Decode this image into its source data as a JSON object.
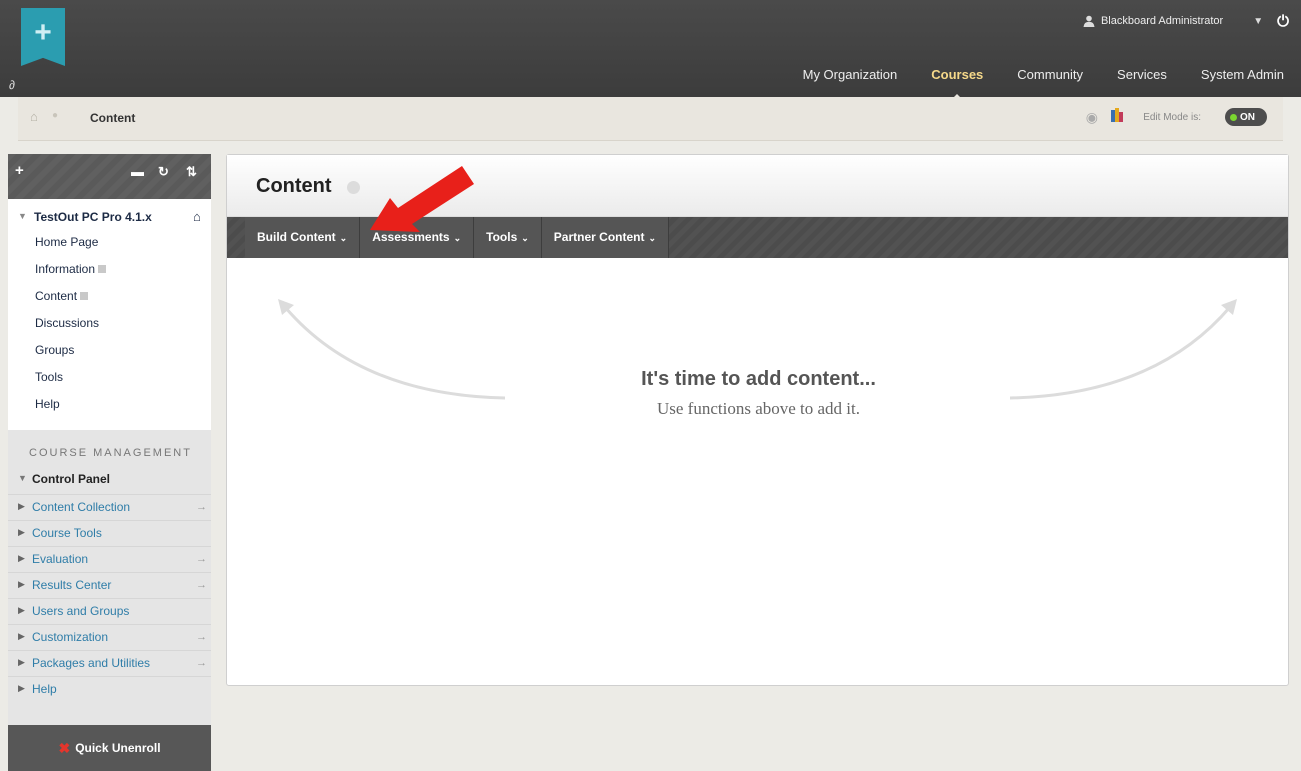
{
  "header": {
    "user_name": "Blackboard Administrator",
    "nav_tabs": [
      "My Organization",
      "Courses",
      "Community",
      "Services",
      "System Admin"
    ],
    "active_tab": "Courses"
  },
  "breadcrumb": {
    "current": "Content",
    "edit_mode_label": "Edit Mode is:",
    "edit_mode_state": "ON"
  },
  "course_menu": {
    "course_title": "TestOut PC Pro 4.1.x",
    "links": [
      "Home Page",
      "Information",
      "Content",
      "Discussions",
      "Groups",
      "Tools",
      "Help"
    ],
    "management_heading": "COURSE MANAGEMENT",
    "control_panel_label": "Control Panel",
    "control_panel_items": [
      {
        "label": "Content Collection",
        "arrow": true
      },
      {
        "label": "Course Tools",
        "arrow": false
      },
      {
        "label": "Evaluation",
        "arrow": true
      },
      {
        "label": "Results Center",
        "arrow": true
      },
      {
        "label": "Users and Groups",
        "arrow": false
      },
      {
        "label": "Customization",
        "arrow": true
      },
      {
        "label": "Packages and Utilities",
        "arrow": true
      },
      {
        "label": "Help",
        "arrow": false
      }
    ],
    "quick_unenroll_label": "Quick Unenroll"
  },
  "content": {
    "title": "Content",
    "actions": [
      "Build Content",
      "Assessments",
      "Tools",
      "Partner Content"
    ],
    "empty_title": "It's time to add content...",
    "empty_subtitle": "Use functions above to add it."
  },
  "colors": {
    "header_bg": "#3f3f3f",
    "brand_teal": "#2b9db0",
    "active_tab": "#f6d98a",
    "annotation_arrow": "#e8201a",
    "toggle_on": "#7bd62f"
  }
}
